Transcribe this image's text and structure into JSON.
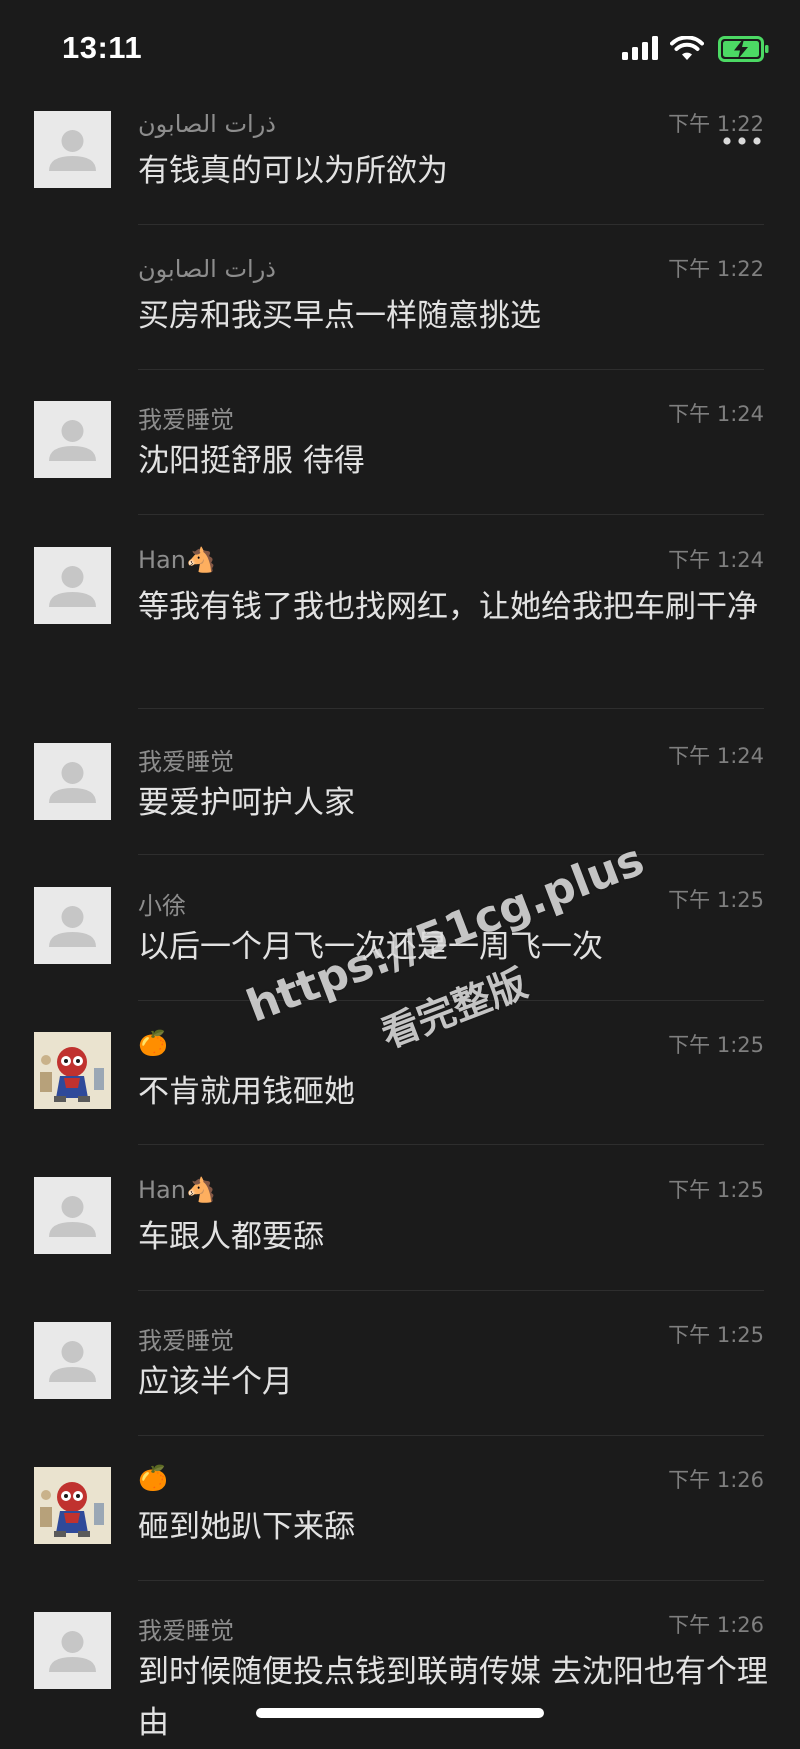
{
  "status_bar": {
    "time": "13:11"
  },
  "header": {
    "back_icon": "chevron-left-icon",
    "more_icon": "more-dots-icon"
  },
  "messages": [
    {
      "sender": "ذرات الصابون",
      "time": "下午 1:22",
      "text": "有钱真的可以为所欲为",
      "avatar": "default"
    },
    {
      "sender": "ذرات الصابون",
      "time": "下午 1:22",
      "text": "买房和我买早点一样随意挑选",
      "avatar": "none"
    },
    {
      "sender": "我爱睡觉",
      "time": "下午 1:24",
      "text": "沈阳挺舒服 待得",
      "avatar": "default"
    },
    {
      "sender": "Han🐴",
      "time": "下午 1:24",
      "text": "等我有钱了我也找网红，让她给我把车刷干净",
      "avatar": "default"
    },
    {
      "sender": "我爱睡觉",
      "time": "下午 1:24",
      "text": "要爱护呵护人家",
      "avatar": "default"
    },
    {
      "sender": "小徐",
      "time": "下午 1:25",
      "text": "以后一个月飞一次还是一周飞一次",
      "avatar": "default"
    },
    {
      "sender": "🍊",
      "time": "下午 1:25",
      "text": "不肯就用钱砸她",
      "avatar": "art"
    },
    {
      "sender": "Han🐴",
      "time": "下午 1:25",
      "text": "车跟人都要舔",
      "avatar": "default"
    },
    {
      "sender": "我爱睡觉",
      "time": "下午 1:25",
      "text": "应该半个月",
      "avatar": "default"
    },
    {
      "sender": "🍊",
      "time": "下午 1:26",
      "text": "砸到她趴下来舔",
      "avatar": "art"
    },
    {
      "sender": "我爱睡觉",
      "time": "下午 1:26",
      "text": "到时候随便投点钱到联萌传媒 去沈阳也有个理由",
      "avatar": "default"
    }
  ],
  "watermark": {
    "line1": "https://51cg.plus",
    "line2": "看完整版"
  },
  "colors": {
    "background": "#1b1b1b",
    "text": "#e2e2e2",
    "meta": "#8d8d8d",
    "battery": "#4cd964"
  }
}
